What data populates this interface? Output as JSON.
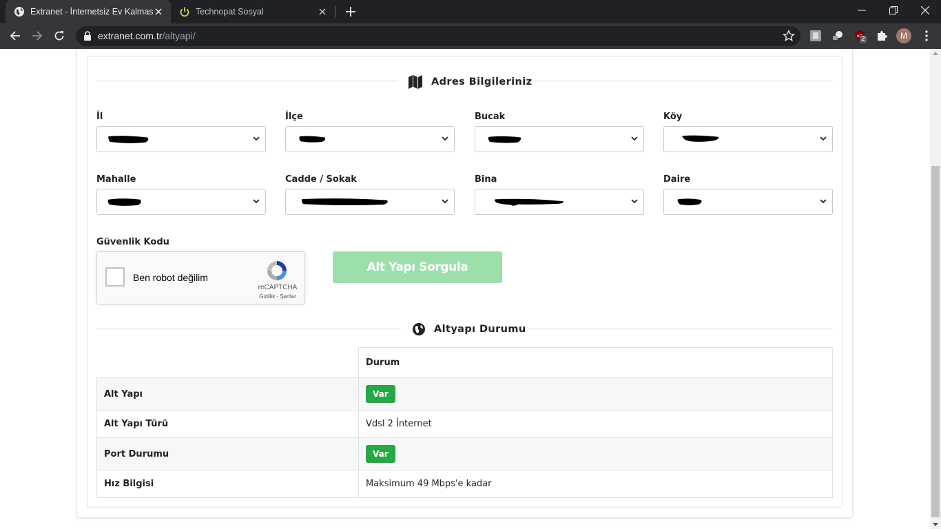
{
  "browser": {
    "tabs": [
      {
        "title": "Extranet - İnternetsiz Ev Kalmasın",
        "active": true
      },
      {
        "title": "Technopat Sosyal",
        "active": false
      }
    ],
    "url_host": "extranet.com.tr",
    "url_path": "/altyapi/",
    "extension_badge": "2",
    "profile_initial": "M"
  },
  "address": {
    "heading": "Adres Bilgileriniz",
    "fields": [
      {
        "label": "İl"
      },
      {
        "label": "İlçe"
      },
      {
        "label": "Bucak"
      },
      {
        "label": "Köy"
      },
      {
        "label": "Mahalle"
      },
      {
        "label": "Cadde / Sokak"
      },
      {
        "label": "Bina"
      },
      {
        "label": "Daire"
      }
    ]
  },
  "security": {
    "label": "Güvenlik Kodu",
    "captcha_label": "Ben robot değilim",
    "captcha_brand": "reCAPTCHA",
    "captcha_terms": "Gizlilik - Şartlar"
  },
  "query_button": "Alt Yapı Sorgula",
  "status": {
    "heading": "Altyapı Durumu",
    "column_header": "Durum",
    "rows": [
      {
        "label": "Alt Yapı",
        "value": "Var",
        "badge": true
      },
      {
        "label": "Alt Yapı Türü",
        "value": "Vdsl 2 İnternet",
        "badge": false
      },
      {
        "label": "Port Durumu",
        "value": "Var",
        "badge": true
      },
      {
        "label": "Hız Bilgisi",
        "value": "Maksimum 49 Mbps'e kadar",
        "badge": false
      }
    ]
  },
  "colors": {
    "badge_green": "#28a745",
    "button_disabled_green": "#9ddfab",
    "chrome_dark": "#202124"
  }
}
